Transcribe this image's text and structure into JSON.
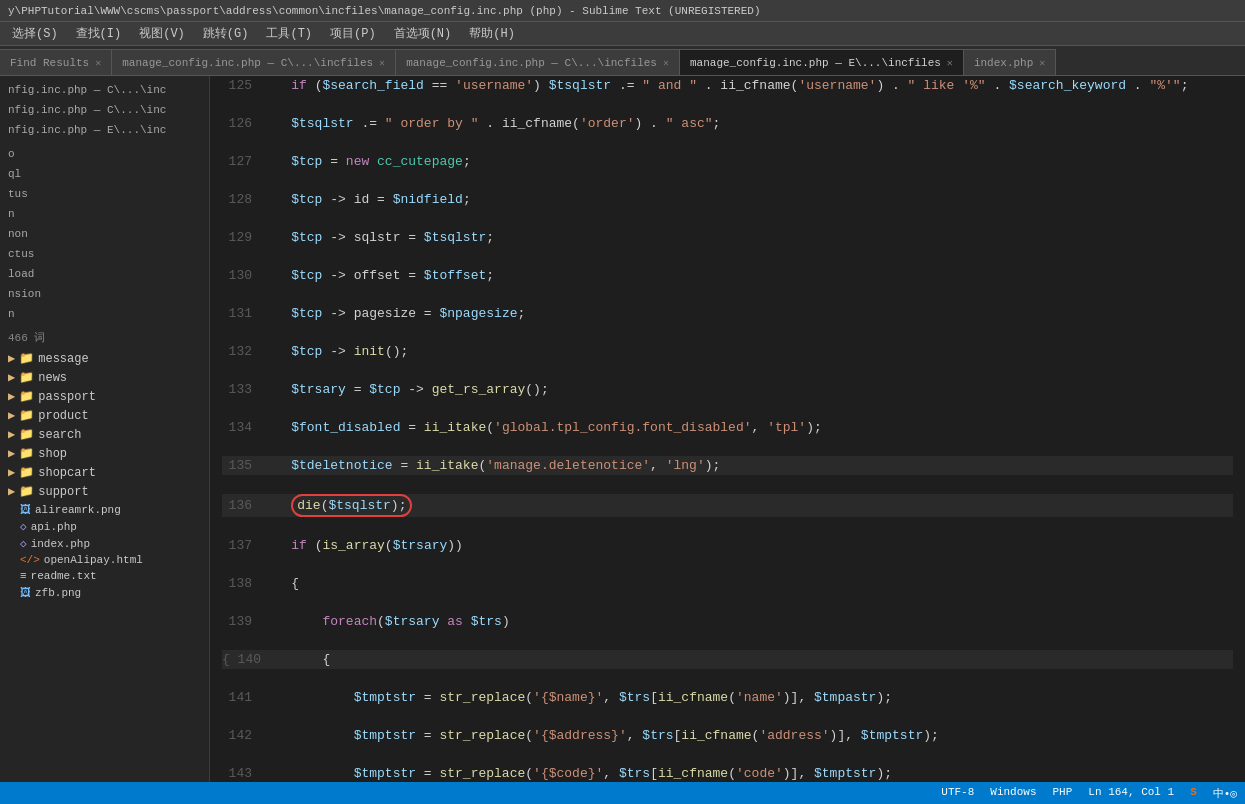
{
  "titleBar": {
    "text": "y\\PHPTutorial\\WWW\\cscms\\passport\\address\\common\\incfiles\\manage_config.inc.php (php) - Sublime Text (UNREGISTERED)"
  },
  "menuBar": {
    "items": [
      "选择(S)",
      "查找(I)",
      "视图(V)",
      "跳转(G)",
      "工具(T)",
      "项目(P)",
      "首选项(N)",
      "帮助(H)"
    ]
  },
  "tabs": [
    {
      "label": "Find Results",
      "active": false,
      "closeable": true
    },
    {
      "label": "manage_config.inc.php — C\\...\\incfiles",
      "active": false,
      "closeable": true
    },
    {
      "label": "manage_config.inc.php — C\\...\\incfiles",
      "active": false,
      "closeable": true
    },
    {
      "label": "manage_config.inc.php — E\\...\\incfiles",
      "active": true,
      "closeable": true
    },
    {
      "label": "index.php",
      "active": false,
      "closeable": true
    }
  ],
  "sidebar": {
    "openFiles": [
      "nfig.inc.php — C\\...\\inc",
      "nfig.inc.php — C\\...\\inc",
      "nfig.inc.php — E\\...\\inc"
    ],
    "wordCount": "466 词",
    "folders": [
      {
        "name": "message",
        "type": "folder"
      },
      {
        "name": "news",
        "type": "folder"
      },
      {
        "name": "passport",
        "type": "folder"
      },
      {
        "name": "product",
        "type": "folder"
      },
      {
        "name": "search",
        "type": "folder"
      },
      {
        "name": "shop",
        "type": "folder"
      },
      {
        "name": "shopcart",
        "type": "folder"
      },
      {
        "name": "support",
        "type": "folder"
      }
    ],
    "files": [
      {
        "name": "alireamrk.png",
        "type": "png"
      },
      {
        "name": "api.php",
        "type": "php"
      },
      {
        "name": "index.php",
        "type": "php"
      },
      {
        "name": "openAlipay.html",
        "type": "html"
      },
      {
        "name": "readme.txt",
        "type": "txt"
      },
      {
        "name": "zfb.png",
        "type": "png"
      }
    ]
  },
  "statusBar": {
    "left": "",
    "encoding": "UTF-8",
    "lineEnding": "Windows",
    "language": "PHP",
    "position": "Ln 164, Col 1"
  },
  "colors": {
    "accent": "#007acc",
    "background": "#1e1e1e",
    "sidebar": "#252526"
  }
}
